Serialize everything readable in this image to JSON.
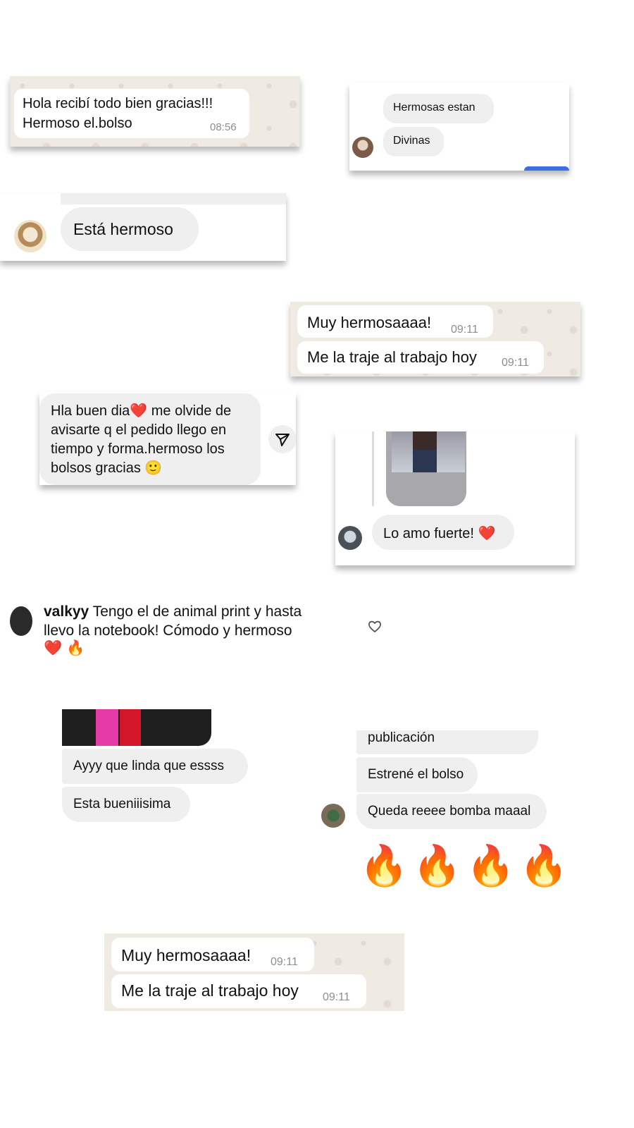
{
  "screenshot_1": {
    "line1": "Hola recibí todo bien gracias!!!",
    "line2": "Hermoso el.bolso",
    "time": "08:56"
  },
  "screenshot_2": {
    "messages": [
      "Hermosas estan",
      "Divinas"
    ]
  },
  "screenshot_3": {
    "message": "Está hermoso"
  },
  "screenshot_4": {
    "messages": [
      {
        "text": "Muy hermosaaaa!",
        "time": "09:11"
      },
      {
        "text": "Me la traje al trabajo hoy",
        "time": "09:11"
      }
    ]
  },
  "screenshot_5": {
    "lines": [
      "Hla buen dia❤️ me olvide de",
      "avisarte q el pedido llego en",
      "tiempo y forma.hermoso los",
      "bolsos gracias 🙂"
    ],
    "share_icon": "send-icon"
  },
  "screenshot_6": {
    "message": "Lo amo fuerte! ❤️"
  },
  "screenshot_7": {
    "username": "valkyy",
    "comment_line1": "Tengo el de animal print y hasta",
    "comment_line2": "llevo la notebook! Cómodo y hermoso",
    "comment_line3": "❤️ 🔥",
    "like_icon": "heart-outline-icon"
  },
  "screenshot_8": {
    "messages": [
      "Ayyy que linda que essss",
      "Esta bueniiisima"
    ]
  },
  "screenshot_9": {
    "messages": [
      "publicación",
      "Estrené el bolso",
      "Queda reeee bomba maaal"
    ],
    "emojis": "🔥🔥🔥🔥"
  },
  "screenshot_10": {
    "messages": [
      {
        "text": "Muy hermosaaaa!",
        "time": "09:11"
      },
      {
        "text": "Me la traje al trabajo hoy",
        "time": "09:11"
      }
    ]
  },
  "colors": {
    "wa_background": "#efeae2",
    "ig_bubble": "#efeff0",
    "heart_red": "#e0242b",
    "ig_blue": "#3d6fe0"
  }
}
